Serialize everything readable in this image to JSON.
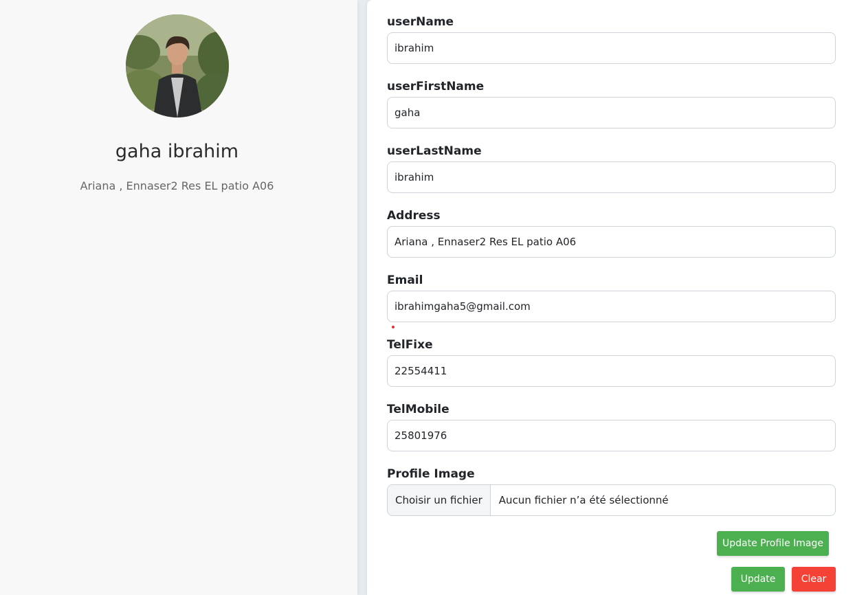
{
  "profile": {
    "full_name": "gaha ibrahim",
    "address": "Ariana , Ennaser2 Res EL patio A06"
  },
  "form": {
    "username": {
      "label": "userName",
      "value": "ibrahim"
    },
    "first_name": {
      "label": "userFirstName",
      "value": "gaha"
    },
    "last_name": {
      "label": "userLastName",
      "value": "ibrahim"
    },
    "address": {
      "label": "Address",
      "value": "Ariana , Ennaser2 Res EL patio A06"
    },
    "email": {
      "label": "Email",
      "value": "ibrahimgaha5@gmail.com"
    },
    "tel_fixe": {
      "label": "TelFixe",
      "value": "22554411"
    },
    "tel_mobile": {
      "label": "TelMobile",
      "value": "25801976"
    },
    "profile_image": {
      "label": "Profile Image",
      "choose_label": "Choisir un fichier",
      "status": "Aucun fichier n’a été sélectionné"
    }
  },
  "buttons": {
    "update_image": "Update Profile Image",
    "update": "Update",
    "clear": "Clear"
  },
  "colors": {
    "primary_green": "#4caf50",
    "danger_red": "#f44336"
  }
}
